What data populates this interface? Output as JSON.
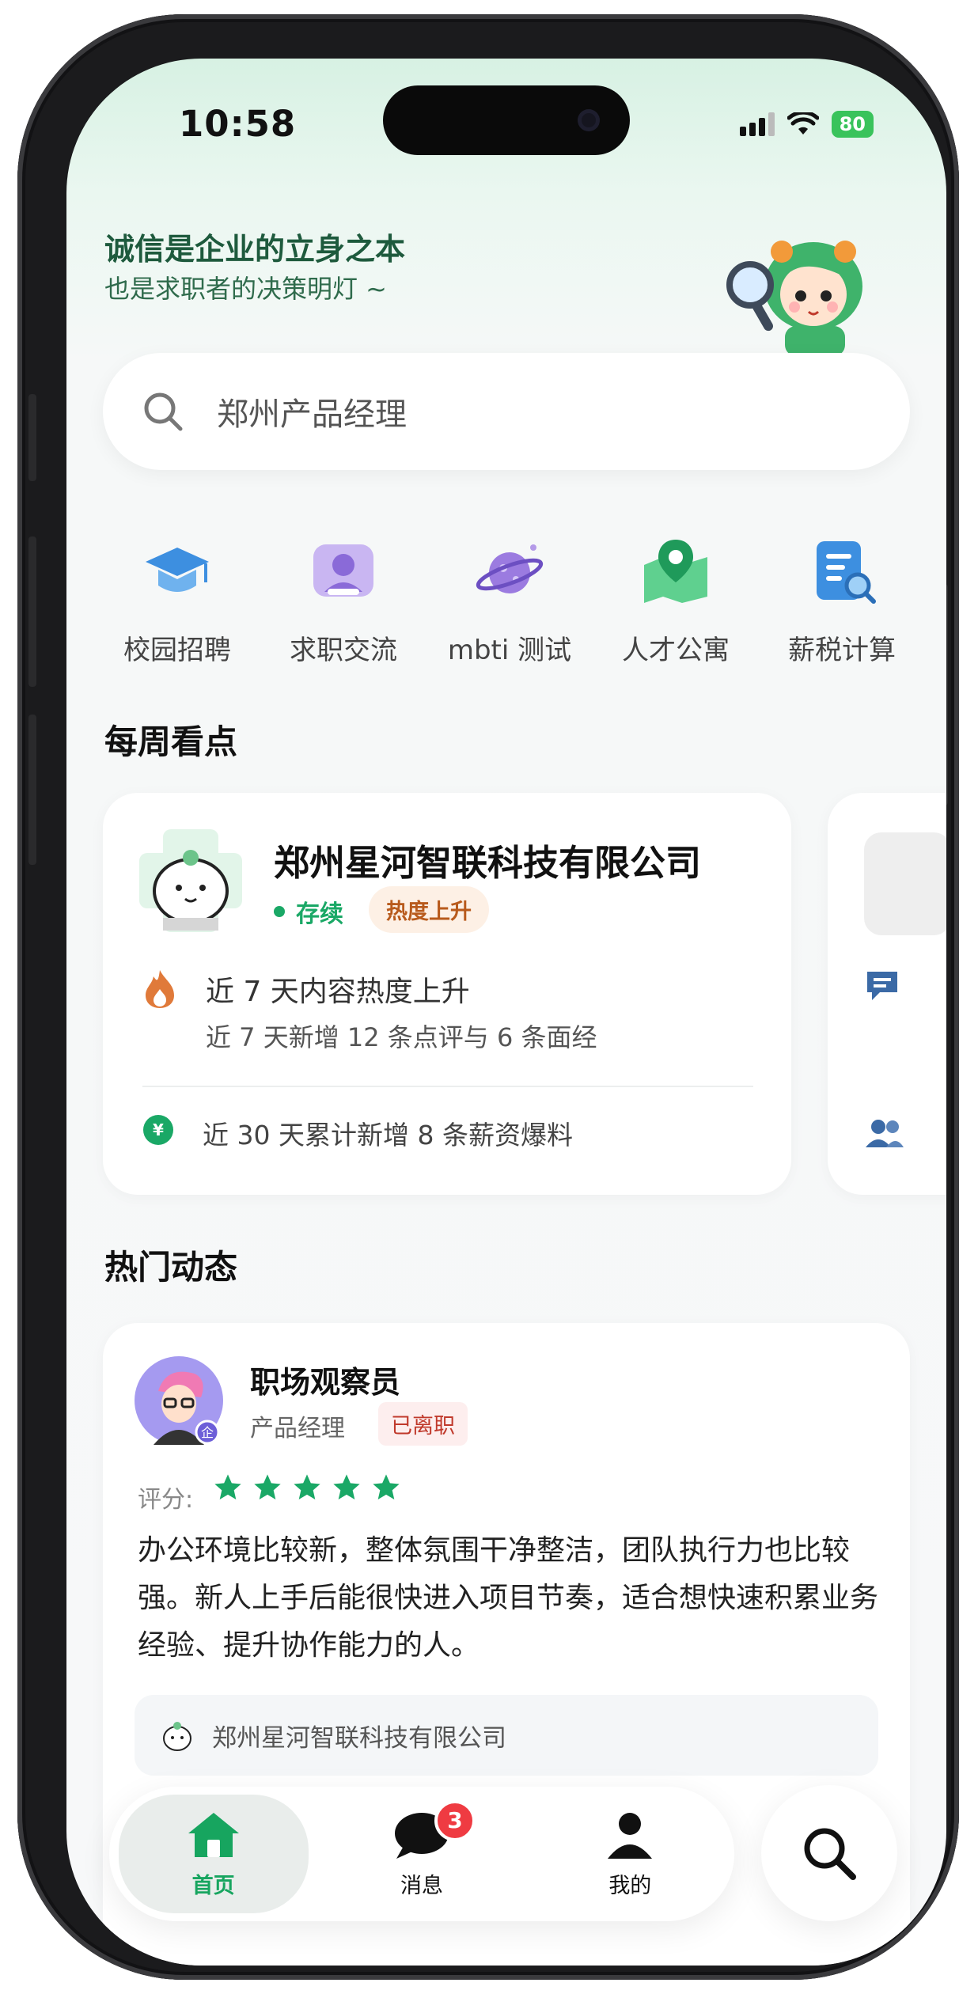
{
  "status_bar": {
    "time": "10:58",
    "battery": "80"
  },
  "header": {
    "tagline_main": "诚信是企业的立身之本",
    "tagline_sub": "也是求职者的决策明灯 ~"
  },
  "search": {
    "placeholder": "郑州产品经理"
  },
  "quick_entries": [
    {
      "label": "校园招聘",
      "icon": "graduation-cap-icon"
    },
    {
      "label": "求职交流",
      "icon": "people-chat-icon"
    },
    {
      "label": "mbti 测试",
      "icon": "planet-icon"
    },
    {
      "label": "人才公寓",
      "icon": "map-pin-icon"
    },
    {
      "label": "薪税计算",
      "icon": "tax-document-icon"
    }
  ],
  "weekly": {
    "title": "每周看点",
    "card": {
      "company": "郑州星河智联科技有限公司",
      "status": "存续",
      "heat_tag": "热度上升",
      "heat_title": "近 7 天内容热度上升",
      "heat_detail": "近 7 天新增 12 条点评与 6 条面经",
      "salary_note": "近 30 天累计新增 8 条薪资爆料"
    }
  },
  "hot": {
    "title": "热门动态",
    "post": {
      "username": "职场观察员",
      "role": "产品经理",
      "tag": "已离职",
      "rating_label": "评分:",
      "rating": 5,
      "text": "办公环境比较新，整体氛围干净整洁，团队执行力也比较强。新人上手后能很快进入项目节奏，适合想快速积累业务经验、提升协作能力的人。",
      "company": "郑州星河智联科技有限公司"
    }
  },
  "tabbar": {
    "tabs": [
      {
        "label": "首页",
        "active": true
      },
      {
        "label": "消息",
        "badge": "3"
      },
      {
        "label": "我的"
      }
    ]
  },
  "colors": {
    "accent": "#17a55f",
    "badge": "#ef3b42",
    "heat": "#b85a1c"
  }
}
